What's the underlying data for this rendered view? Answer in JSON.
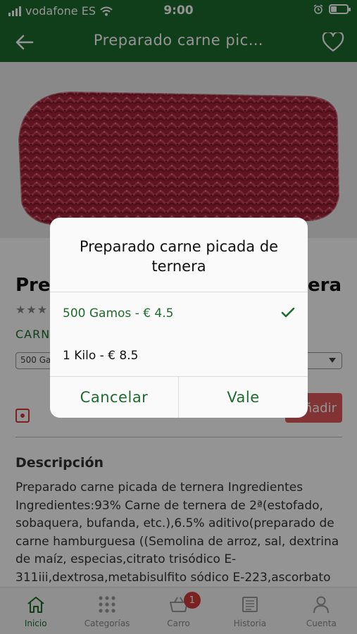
{
  "status_bar": {
    "carrier": "vodafone ES",
    "time": "9:00"
  },
  "nav": {
    "title": "Preparado carne pic…"
  },
  "product": {
    "name_start": "Prep",
    "name_end": "era",
    "rating_stars": "★★★",
    "category_start": "CARN",
    "selected_variant_start": "500 Ga",
    "add_button_label": "ñadir"
  },
  "description": {
    "title": "Descripción",
    "body": "Preparado carne picada de ternera Ingredientes Ingredientes:93% Carne de ternera de 2ª(estofado, sobaquera, bufanda, etc.),6.5% aditivo(preparado de carne hamburguesa ((Semolina de arroz, sal, dextrina de maíz, especias,citrato trisódico E-311iii,dextrosa,metabisulfito sódico E-223,ascorbato"
  },
  "dialog": {
    "title": "Preparado carne picada de ternera",
    "options": [
      {
        "label": "500 Gamos - € 4.5",
        "selected": true
      },
      {
        "label": "1 Kilo - € 8.5",
        "selected": false
      }
    ],
    "cancel_label": "Cancelar",
    "ok_label": "Vale"
  },
  "tabs": [
    {
      "label": "Inicio",
      "active": true,
      "icon": "home-icon"
    },
    {
      "label": "Categorías",
      "active": false,
      "icon": "grid-icon"
    },
    {
      "label": "Carro",
      "active": false,
      "icon": "cart-icon",
      "badge": "1"
    },
    {
      "label": "Historia",
      "active": false,
      "icon": "newspaper-icon"
    },
    {
      "label": "Cuenta",
      "active": false,
      "icon": "user-icon"
    }
  ],
  "colors": {
    "primary": "#1e6b2e",
    "accent_red": "#d23b3b",
    "overlay": "rgba(0,0,0,0.42)"
  }
}
